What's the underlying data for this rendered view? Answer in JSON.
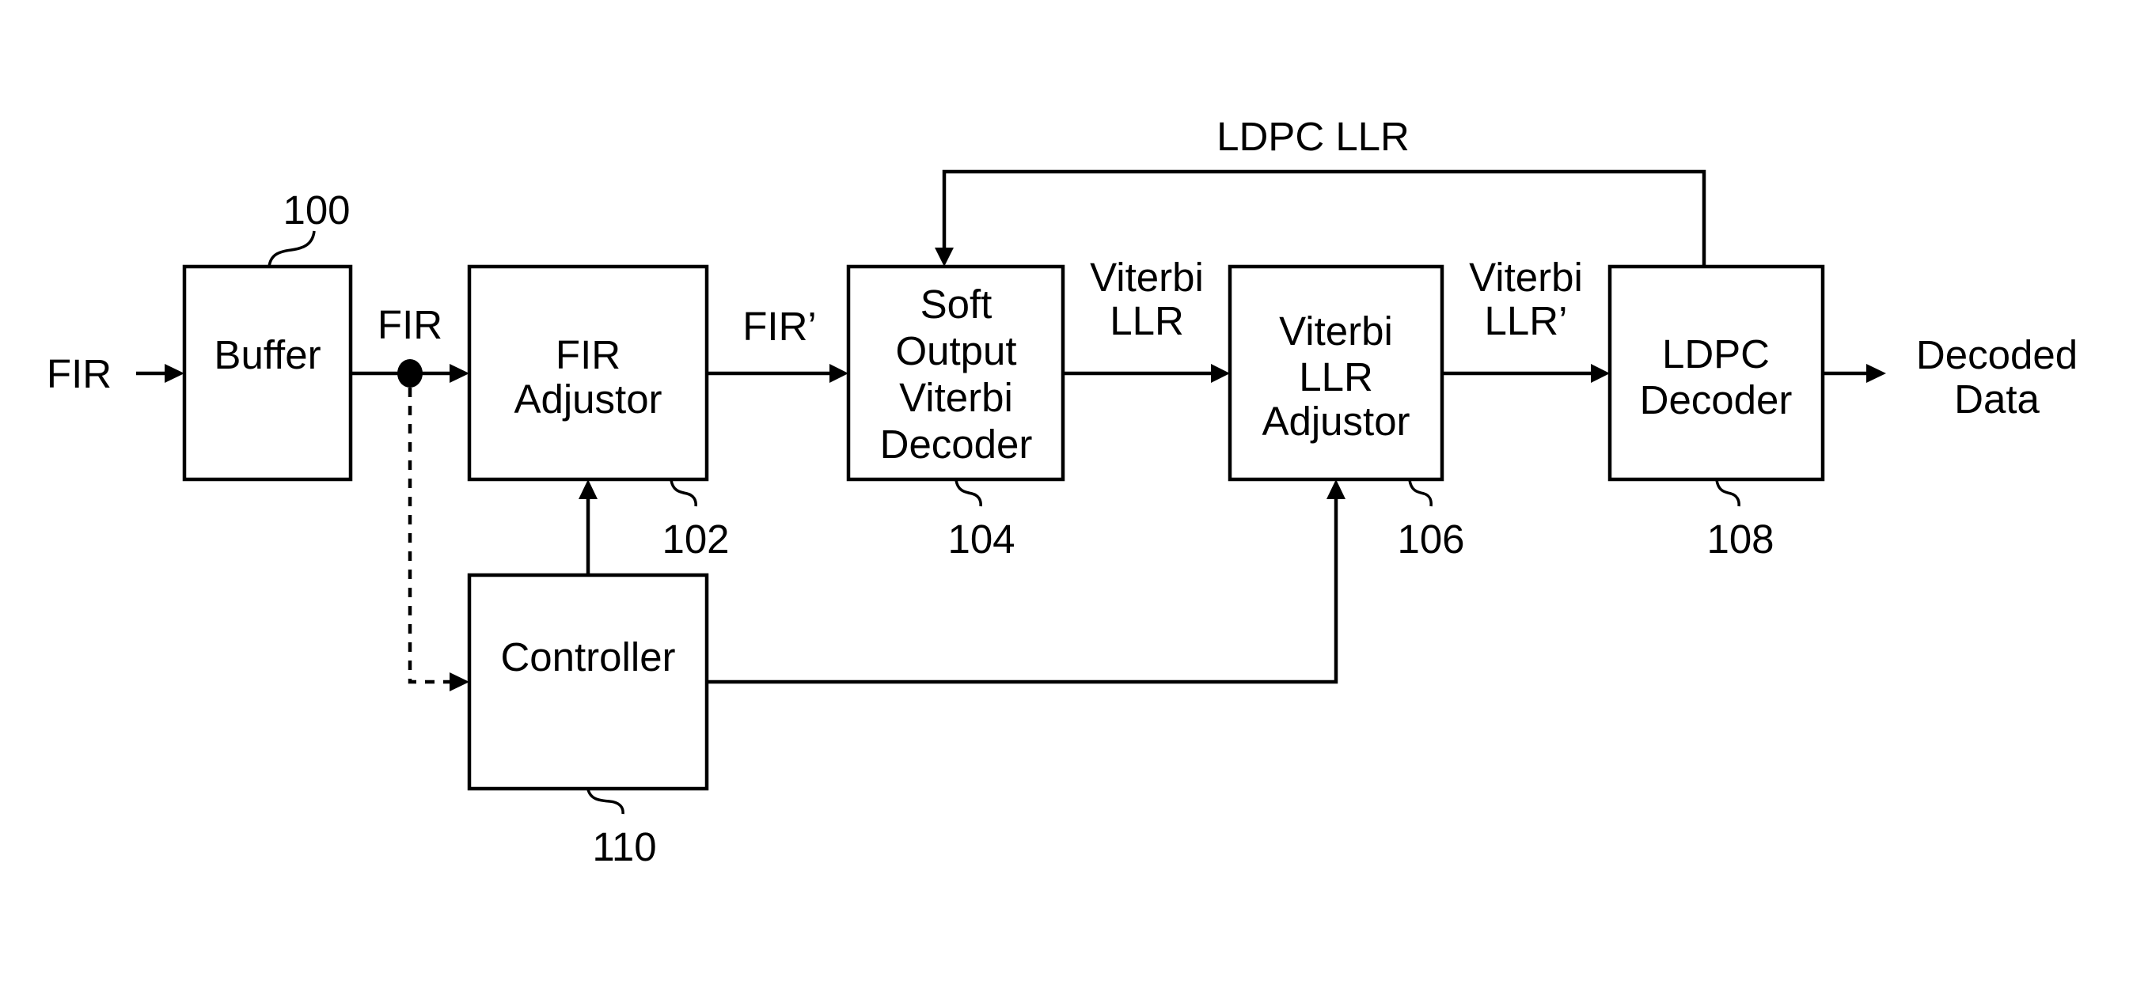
{
  "diagram": {
    "type": "block-diagram",
    "blocks": {
      "buffer": {
        "lines": [
          "Buffer"
        ],
        "ref": "100"
      },
      "fir_adjustor": {
        "lines": [
          "FIR",
          "Adjustor"
        ],
        "ref": "102"
      },
      "sovd": {
        "lines": [
          "Soft",
          "Output",
          "Viterbi",
          "Decoder"
        ],
        "ref": "104"
      },
      "viterbi_llr_adjustor": {
        "lines": [
          "Viterbi",
          "LLR",
          "Adjustor"
        ],
        "ref": "106"
      },
      "ldpc_decoder": {
        "lines": [
          "LDPC",
          "Decoder"
        ],
        "ref": "108"
      },
      "controller": {
        "lines": [
          "Controller"
        ],
        "ref": "110"
      }
    },
    "signals": {
      "input": "FIR",
      "buffer_out": "FIR",
      "fir_prime": "FIR’",
      "viterbi_llr": [
        "Viterbi",
        "LLR"
      ],
      "viterbi_llr_prime": [
        "Viterbi",
        "LLR’"
      ],
      "ldpc_llr": "LDPC LLR",
      "output": [
        "Decoded",
        "Data"
      ]
    },
    "connections": [
      {
        "from": "input",
        "to": "buffer",
        "style": "solid"
      },
      {
        "from": "buffer",
        "to": "fir_adjustor",
        "label": "FIR",
        "style": "solid"
      },
      {
        "from": "buffer",
        "to": "controller",
        "style": "dashed"
      },
      {
        "from": "fir_adjustor",
        "to": "sovd",
        "label": "FIR’",
        "style": "solid"
      },
      {
        "from": "sovd",
        "to": "viterbi_llr_adjustor",
        "label": "Viterbi LLR",
        "style": "solid"
      },
      {
        "from": "viterbi_llr_adjustor",
        "to": "ldpc_decoder",
        "label": "Viterbi LLR’",
        "style": "solid"
      },
      {
        "from": "ldpc_decoder",
        "to": "sovd",
        "label": "LDPC LLR",
        "style": "solid"
      },
      {
        "from": "ldpc_decoder",
        "to": "output",
        "label": "Decoded Data",
        "style": "solid"
      },
      {
        "from": "controller",
        "to": "fir_adjustor",
        "style": "solid"
      },
      {
        "from": "controller",
        "to": "viterbi_llr_adjustor",
        "style": "solid"
      }
    ]
  }
}
